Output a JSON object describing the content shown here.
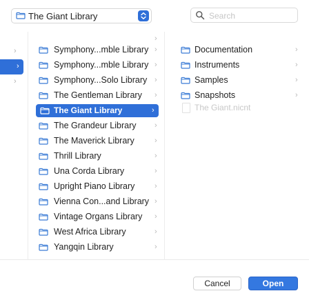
{
  "path_popup": {
    "label": "The Giant Library"
  },
  "search": {
    "placeholder": "Search",
    "value": ""
  },
  "columns": {
    "middle": [
      "Symphony...mble Library",
      "Symphony...mble Library",
      "Symphony...Solo Library",
      "The Gentleman Library",
      "The Giant Library",
      "The Grandeur Library",
      "The Maverick Library",
      "Thrill Library",
      "Una Corda Library",
      "Upright Piano Library",
      "Vienna Con...and Library",
      "Vintage Organs Library",
      "West Africa Library",
      "Yangqin Library"
    ],
    "middle_selected": "The Giant Library",
    "right_folders": [
      "Documentation",
      "Instruments",
      "Samples",
      "Snapshots"
    ],
    "right_file": "The Giant.nicnt"
  },
  "buttons": {
    "cancel": "Cancel",
    "open": "Open"
  },
  "colors": {
    "accent": "#2f6fd8",
    "folder": "#3a7bd5"
  }
}
